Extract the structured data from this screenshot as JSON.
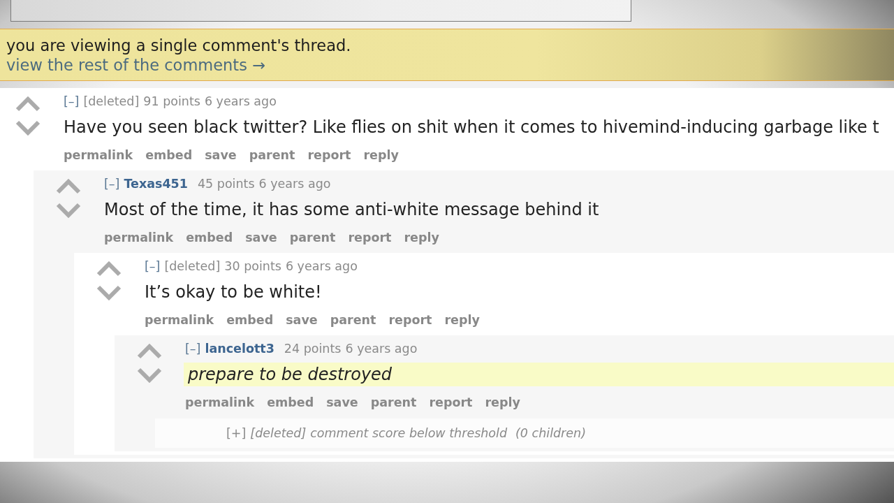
{
  "banner": {
    "message": "you are viewing a single comment's thread.",
    "link": "view the rest of the comments →"
  },
  "comments": [
    {
      "kind": "comment",
      "toggle": "[–]",
      "author": "[deleted]",
      "deleted": true,
      "score": "91 points",
      "time": "6 years ago",
      "body": "Have you seen black twitter? Like flies on shit when it comes to hivemind-inducing garbage like t",
      "highlighted": false,
      "italic": false,
      "actions": [
        "permalink",
        "embed",
        "save",
        "parent",
        "report",
        "reply"
      ],
      "children": [
        {
          "kind": "comment",
          "toggle": "[–]",
          "author": "Texas451",
          "deleted": false,
          "score": "45 points",
          "time": "6 years ago",
          "body": "Most of the time, it has some anti-white message behind it",
          "highlighted": false,
          "italic": false,
          "actions": [
            "permalink",
            "embed",
            "save",
            "parent",
            "report",
            "reply"
          ],
          "children": [
            {
              "kind": "comment",
              "toggle": "[–]",
              "author": "[deleted]",
              "deleted": true,
              "score": "30 points",
              "time": "6 years ago",
              "body": "It’s okay to be white!",
              "highlighted": false,
              "italic": false,
              "actions": [
                "permalink",
                "embed",
                "save",
                "parent",
                "report",
                "reply"
              ],
              "children": [
                {
                  "kind": "comment",
                  "toggle": "[–]",
                  "author": "lancelott3",
                  "deleted": false,
                  "score": "24 points",
                  "time": "6 years ago",
                  "body": "prepare to be destroyed",
                  "highlighted": true,
                  "italic": true,
                  "actions": [
                    "permalink",
                    "embed",
                    "save",
                    "parent",
                    "report",
                    "reply"
                  ],
                  "children": [
                    {
                      "kind": "collapsed",
                      "toggle": "[+]",
                      "author": "[deleted]",
                      "note": "comment score below threshold",
                      "child_count": "(0 children)"
                    }
                  ]
                }
              ]
            }
          ]
        }
      ]
    }
  ]
}
